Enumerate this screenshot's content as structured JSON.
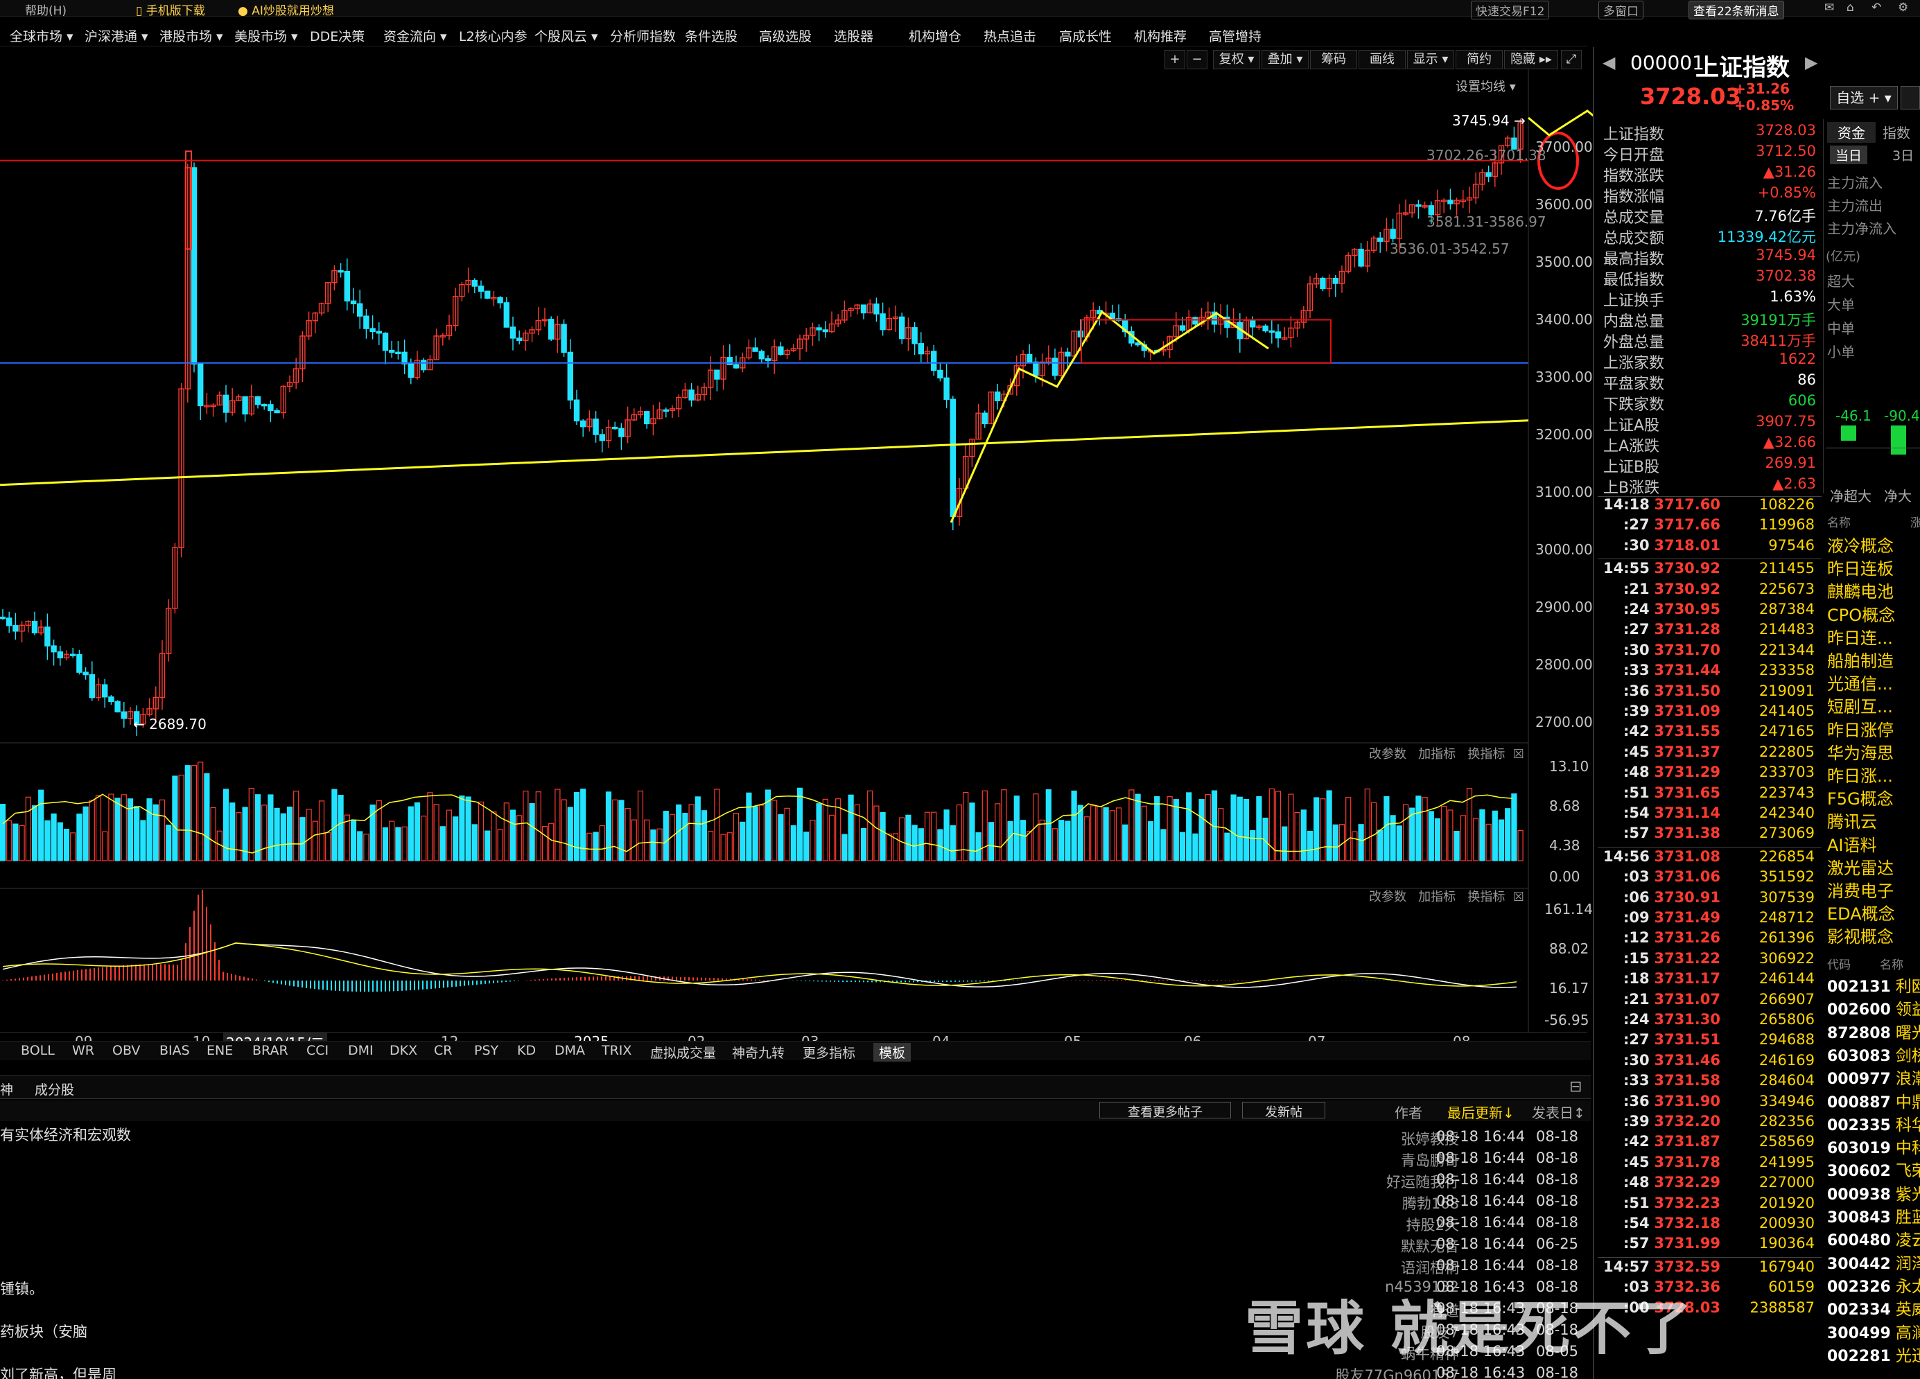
{
  "topbar": {
    "help": "帮助(H)",
    "app_download": "手机版下载",
    "ai_promo": "AI炒股就用炒想",
    "quick_trade": "快速交易F12",
    "multi_window": "多窗口",
    "news": "查看22条新消息"
  },
  "nav": [
    "全球市场 ▾",
    "沪深港通 ▾",
    "港股市场 ▾",
    "美股市场 ▾",
    "DDE决策",
    "资金流向 ▾",
    "L2核心内参",
    "个股风云 ▾",
    "分析师指数",
    "条件选股",
    "高级选股",
    "选股器",
    "机构增仓",
    "热点追击",
    "高成长性",
    "机构推荐",
    "高管增持"
  ],
  "toolbar": {
    "plus": "+",
    "minus": "−",
    "fuquan": "复权 ▾",
    "overlay": "叠加 ▾",
    "chips": "筹码",
    "draw": "画线",
    "display": "显示 ▾",
    "simple": "简约",
    "hide": "隐藏 ▸▸",
    "ma_setting": "设置均线 ▾"
  },
  "index": {
    "code": "000001",
    "name": "上证指数",
    "price": "3728.03",
    "change": "+31.26",
    "change_pct": "+0.85%",
    "watchlist": "自选 + ▾"
  },
  "stats": [
    {
      "label": "上证指数",
      "value": "3728.03",
      "color": "red"
    },
    {
      "label": "今日开盘",
      "value": "3712.50",
      "color": "red"
    },
    {
      "label": "指数涨跌",
      "value": "▲31.26",
      "color": "red"
    },
    {
      "label": "指数涨幅",
      "value": "+0.85%",
      "color": "red"
    },
    {
      "label": "总成交量",
      "value": "7.76亿手",
      "color": "white"
    },
    {
      "label": "总成交额",
      "value": "11339.42亿元",
      "color": "cyan"
    },
    {
      "label": "最高指数",
      "value": "3745.94",
      "color": "red"
    },
    {
      "label": "最低指数",
      "value": "3702.38",
      "color": "red"
    },
    {
      "label": "上证换手",
      "value": "1.63%",
      "color": "white"
    },
    {
      "label": "内盘总量",
      "value": "39191万手",
      "color": "green"
    },
    {
      "label": "外盘总量",
      "value": "38411万手",
      "color": "red"
    },
    {
      "label": "上涨家数",
      "value": "1622",
      "color": "red"
    },
    {
      "label": "平盘家数",
      "value": "86",
      "color": "white"
    },
    {
      "label": "下跌家数",
      "value": "606",
      "color": "green"
    },
    {
      "label": "上证A股",
      "value": "3907.75",
      "color": "red"
    },
    {
      "label": "上A涨跌",
      "value": "▲32.66",
      "color": "red"
    },
    {
      "label": "上证B股",
      "value": "269.91",
      "color": "red"
    },
    {
      "label": "上B涨跌",
      "value": "▲2.63",
      "color": "red"
    }
  ],
  "fund_tabs": {
    "fund": "资金",
    "index": "指数",
    "today": "当日",
    "three_days": "3日"
  },
  "fund_flow": [
    "主力流入",
    "主力流出",
    "主力净流入"
  ],
  "fund_unit": "(亿元)",
  "fund_sizes": [
    "超大",
    "大单",
    "中单",
    "小单"
  ],
  "fund_bars": {
    "v1": "-46.1",
    "v2": "-90.4",
    "l1": "净超大",
    "l2": "净大"
  },
  "ticks": [
    {
      "t": "14:18",
      "p": "3717.60",
      "v": "108226"
    },
    {
      "t": ":27",
      "p": "3717.66",
      "v": "119968"
    },
    {
      "t": ":30",
      "p": "3718.01",
      "v": "97546"
    },
    {
      "t": "14:55",
      "p": "3730.92",
      "v": "211455"
    },
    {
      "t": ":21",
      "p": "3730.92",
      "v": "225673"
    },
    {
      "t": ":24",
      "p": "3730.95",
      "v": "287384"
    },
    {
      "t": ":27",
      "p": "3731.28",
      "v": "214483"
    },
    {
      "t": ":30",
      "p": "3731.70",
      "v": "221344"
    },
    {
      "t": ":33",
      "p": "3731.44",
      "v": "233358"
    },
    {
      "t": ":36",
      "p": "3731.50",
      "v": "219091"
    },
    {
      "t": ":39",
      "p": "3731.09",
      "v": "241405"
    },
    {
      "t": ":42",
      "p": "3731.55",
      "v": "247165"
    },
    {
      "t": ":45",
      "p": "3731.37",
      "v": "222805"
    },
    {
      "t": ":48",
      "p": "3731.29",
      "v": "233703"
    },
    {
      "t": ":51",
      "p": "3731.65",
      "v": "223743"
    },
    {
      "t": ":54",
      "p": "3731.14",
      "v": "242340"
    },
    {
      "t": ":57",
      "p": "3731.38",
      "v": "273069"
    },
    {
      "t": "14:56",
      "p": "3731.08",
      "v": "226854"
    },
    {
      "t": ":03",
      "p": "3731.06",
      "v": "351592"
    },
    {
      "t": ":06",
      "p": "3730.91",
      "v": "307539"
    },
    {
      "t": ":09",
      "p": "3731.49",
      "v": "248712"
    },
    {
      "t": ":12",
      "p": "3731.26",
      "v": "261396"
    },
    {
      "t": ":15",
      "p": "3731.22",
      "v": "306922"
    },
    {
      "t": ":18",
      "p": "3731.17",
      "v": "246144"
    },
    {
      "t": ":21",
      "p": "3731.07",
      "v": "266907"
    },
    {
      "t": ":24",
      "p": "3731.30",
      "v": "265806"
    },
    {
      "t": ":27",
      "p": "3731.51",
      "v": "294688"
    },
    {
      "t": ":30",
      "p": "3731.46",
      "v": "246169"
    },
    {
      "t": ":33",
      "p": "3731.58",
      "v": "284604"
    },
    {
      "t": ":36",
      "p": "3731.90",
      "v": "334946"
    },
    {
      "t": ":39",
      "p": "3732.20",
      "v": "282356"
    },
    {
      "t": ":42",
      "p": "3731.87",
      "v": "258569"
    },
    {
      "t": ":45",
      "p": "3731.78",
      "v": "241995"
    },
    {
      "t": ":48",
      "p": "3732.29",
      "v": "227000"
    },
    {
      "t": ":51",
      "p": "3732.23",
      "v": "201920"
    },
    {
      "t": ":54",
      "p": "3732.18",
      "v": "200930"
    },
    {
      "t": ":57",
      "p": "3731.99",
      "v": "190364"
    },
    {
      "t": "14:57",
      "p": "3732.59",
      "v": "167940"
    },
    {
      "t": ":03",
      "p": "3732.36",
      "v": "60159"
    },
    {
      "t": ":00",
      "p": "3728.03",
      "v": "2388587"
    }
  ],
  "concepts": [
    "液冷概念",
    "昨日连板",
    "麒麟电池",
    "CPO概念",
    "昨日连...",
    "船舶制造",
    "光通信...",
    "短剧互...",
    "昨日涨停",
    "华为海思",
    "昨日涨...",
    "F5G概念",
    "腾讯云",
    "AI语料",
    "激光雷达",
    "消费电子",
    "EDA概念",
    "影视概念"
  ],
  "concept_headers": {
    "name": "名称",
    "rise": "涨",
    "code": "代码",
    "sname": "名称"
  },
  "stocks": [
    {
      "code": "002131",
      "name": "利欧股"
    },
    {
      "code": "002600",
      "name": "领益智"
    },
    {
      "code": "872808",
      "name": "曙光数"
    },
    {
      "code": "603083",
      "name": "剑桥科"
    },
    {
      "code": "000977",
      "name": "浪潮信"
    },
    {
      "code": "000887",
      "name": "中鼎股"
    },
    {
      "code": "002335",
      "name": "科华数"
    },
    {
      "code": "603019",
      "name": "中科曙"
    },
    {
      "code": "300602",
      "name": "飞荣达"
    },
    {
      "code": "000938",
      "name": "紫光股"
    },
    {
      "code": "300843",
      "name": "胜蓝股"
    },
    {
      "code": "600480",
      "name": "凌云股"
    },
    {
      "code": "300442",
      "name": "润泽科"
    },
    {
      "code": "002326",
      "name": "永太科"
    },
    {
      "code": "002334",
      "name": "英威腾"
    },
    {
      "code": "300499",
      "name": "高澜股"
    },
    {
      "code": "002281",
      "name": "光迅科"
    }
  ],
  "chart_labels": {
    "high": "3745.94",
    "low": "2689.70",
    "line1": "3702.26-3701.38",
    "line2": "3581.31-3586.97",
    "line3": "3536.01-3542.57",
    "date_cursor": "2024/10/15/二"
  },
  "price_axis": [
    "3700.00",
    "3600.00",
    "3500.00",
    "3400.00",
    "3300.00",
    "3200.00",
    "3100.00",
    "3000.00",
    "2900.00",
    "2800.00",
    "2700.00"
  ],
  "vol_axis": [
    "13.10",
    "8.68",
    "4.38",
    "0.00"
  ],
  "macd_axis": [
    "161.14",
    "88.02",
    "16.17",
    "-56.95"
  ],
  "months": [
    "09",
    "10",
    "11",
    "12",
    "2025",
    "02",
    "03",
    "04",
    "05",
    "06",
    "07",
    "08"
  ],
  "sub_panel": {
    "edit": "改参数",
    "add": "加指标",
    "switch": "换指标"
  },
  "indicator_tabs": [
    "BOLL",
    "WR",
    "OBV",
    "BIAS",
    "ENE",
    "BRAR",
    "CCI",
    "DMI",
    "DKX",
    "CR",
    "PSY",
    "KD",
    "DMA",
    "TRIX",
    "虚拟成交量",
    "神奇九转",
    "更多指标",
    "模板"
  ],
  "bottom": {
    "tab1": "神",
    "tab2": "成分股",
    "more": "查看更多帖子",
    "post": "发新帖",
    "col_author": "作者",
    "col_updated": "最后更新↓",
    "col_posted": "发表日↕"
  },
  "posts": [
    {
      "title": "有实体经济和宏观数",
      "author": "张婷教授",
      "time": "08-18 16:44",
      "date": "08-18"
    },
    {
      "title": "",
      "author": "青岛鹏哥",
      "time": "08-18 16:44",
      "date": "08-18"
    },
    {
      "title": "",
      "author": "好运随我行",
      "time": "08-18 16:44",
      "date": "08-18"
    },
    {
      "title": "",
      "author": "腾勃168",
      "time": "08-18 16:44",
      "date": "08-18"
    },
    {
      "title": "",
      "author": "持股2天",
      "time": "08-18 16:44",
      "date": "08-18"
    },
    {
      "title": "",
      "author": "默默无音",
      "time": "08-18 16:44",
      "date": "06-25"
    },
    {
      "title": "",
      "author": "语润梧桐",
      "time": "08-18 16:44",
      "date": "08-18"
    },
    {
      "title": "锺镇。",
      "author": "n4539132",
      "time": "08-18 16:43",
      "date": "08-18"
    },
    {
      "title": "",
      "author": "有道",
      "time": "08-18 16:43",
      "date": "08-18"
    },
    {
      "title": "药板块（安脑",
      "author": "股友7",
      "time": "08-18 16:43",
      "date": "08-18"
    },
    {
      "title": "",
      "author": "蜗牛精神",
      "time": "08-18 16:43",
      "date": "08-05"
    },
    {
      "title": "刘了新高，但是周",
      "author": "股友77Gn960157",
      "time": "08-18 16:43",
      "date": "08-18"
    }
  ],
  "watermark": "雪球  就是死不了"
}
